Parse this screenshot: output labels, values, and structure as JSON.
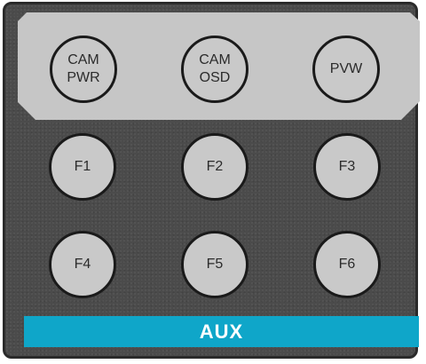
{
  "colors": {
    "panel_background": "#4b4b4b",
    "top_section_background": "#c6c6c6",
    "button_fill": "#c9c9c9",
    "button_border": "#1a1a1a",
    "aux_bar": "#0fa6c9",
    "aux_text": "#ffffff"
  },
  "camera_buttons": [
    {
      "label": "CAM\nPWR"
    },
    {
      "label": "CAM\nOSD"
    },
    {
      "label": "PVW"
    }
  ],
  "function_buttons": [
    {
      "label": "F1"
    },
    {
      "label": "F2"
    },
    {
      "label": "F3"
    },
    {
      "label": "F4"
    },
    {
      "label": "F5"
    },
    {
      "label": "F6"
    }
  ],
  "aux_bar": {
    "label": "AUX"
  }
}
